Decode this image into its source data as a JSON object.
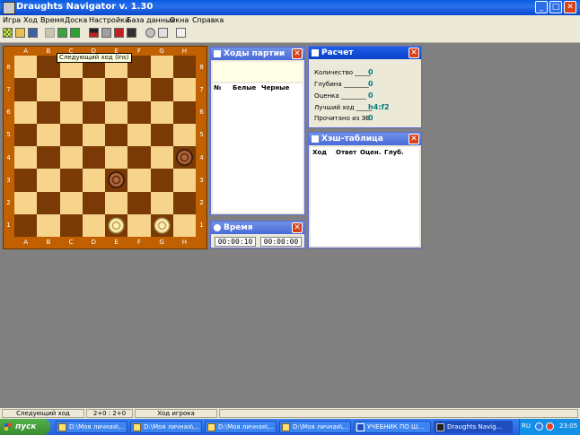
{
  "window": {
    "title": "Draughts Navigator v. 1.30"
  },
  "menu": [
    "Игра",
    "Ход",
    "Время",
    "Доска",
    "Настройки",
    "База данных",
    "Окна",
    "Справка"
  ],
  "tooltip": "Следующий ход (Ins)",
  "board": {
    "files": [
      "A",
      "B",
      "C",
      "D",
      "E",
      "F",
      "G",
      "H"
    ],
    "ranks": [
      "8",
      "7",
      "6",
      "5",
      "4",
      "3",
      "2",
      "1"
    ]
  },
  "moves_window": {
    "title": "Ходы партии",
    "columns": [
      "№",
      "Белые",
      "Черные"
    ]
  },
  "time_window": {
    "title": "Время",
    "white_time": "00:00:10",
    "black_time": "00:00:00"
  },
  "calc_window": {
    "title": "Расчет",
    "rows": [
      {
        "label": "Количество _____",
        "value": "0"
      },
      {
        "label": "Глубина ________",
        "value": "0"
      },
      {
        "label": "Оценка ________",
        "value": "0"
      },
      {
        "label": "Лучший ход _____",
        "value": "h4:f2"
      },
      {
        "label": "Прочитано из ЭБ",
        "value": "0"
      }
    ]
  },
  "hash_window": {
    "title": "Хэш-таблица",
    "columns": [
      "Ход",
      "Ответ",
      "Оцен.",
      "Глуб."
    ]
  },
  "statusbar": {
    "hint": "Следующий ход",
    "score": "2+0 : 2+0",
    "turn": "Ход игрока"
  },
  "taskbar": {
    "start": "пуск",
    "tasks": [
      "D:\\Моя личная\\...",
      "D:\\Моя личная\\...",
      "D:\\Моя личная\\...",
      "D:\\Моя личная\\...",
      "УЧЕБНИК ПО Ш...",
      "Draughts Navig..."
    ],
    "lang": "RU",
    "clock": "23:05"
  },
  "colors": {
    "title_bar": "#0a5ce4",
    "light_square": "#f6d48c",
    "dark_square": "#7a3a06",
    "value_text": "#008080"
  }
}
